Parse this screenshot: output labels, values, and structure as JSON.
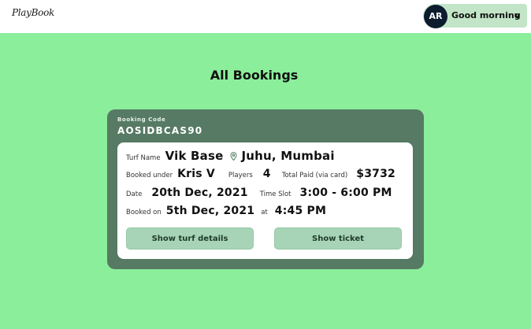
{
  "app": {
    "logo": "PlayBook"
  },
  "user": {
    "initials": "AR",
    "greeting": "Good morning",
    "chevron": "v"
  },
  "page": {
    "title": "All Bookings"
  },
  "booking": {
    "code_label": "Booking Code",
    "code": "AOSIDBCAS90",
    "turf_label": "Turf Name",
    "turf_name": "Vik Base",
    "location": "Juhu, Mumbai",
    "booked_under_label": "Booked under",
    "booked_under": "Kris V",
    "players_label": "Players",
    "players": "4",
    "total_label": "Total Paid (via card)",
    "total": "$3732",
    "date_label": "Date",
    "date": "20th Dec, 2021",
    "slot_label": "Time Slot",
    "slot": "3:00 - 6:00 PM",
    "booked_on_label": "Booked on",
    "booked_on": "5th Dec, 2021",
    "at_label": "at",
    "booked_at": "4:45 PM",
    "show_turf_label": "Show turf details",
    "show_ticket_label": "Show ticket"
  },
  "icons": {
    "location": "location-pin-icon"
  },
  "colors": {
    "background": "#8bee9b",
    "card": "#567a63",
    "button": "#a7d4b6",
    "avatar": "#0d1b2e",
    "user_pill": "#c2e5c7"
  }
}
